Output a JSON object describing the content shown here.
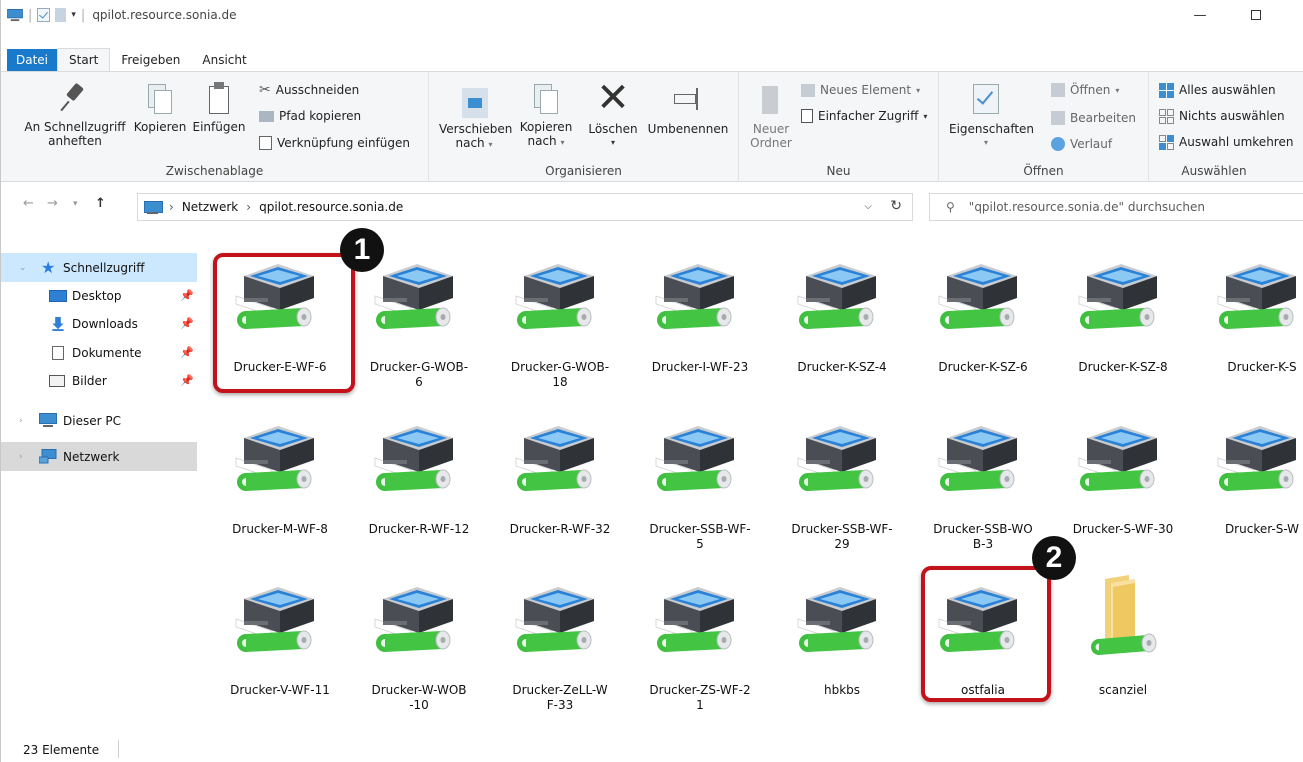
{
  "window": {
    "title": "qpilot.resource.sonia.de"
  },
  "ribbon_tabs": [
    {
      "label": "Datei"
    },
    {
      "label": "Start"
    },
    {
      "label": "Freigeben"
    },
    {
      "label": "Ansicht"
    }
  ],
  "ribbon": {
    "clipboard": {
      "pin_line1": "An Schnellzugriff",
      "pin_line2": "anheften",
      "copy": "Kopieren",
      "paste": "Einfügen",
      "cut": "Ausschneiden",
      "copy_path": "Pfad kopieren",
      "paste_shortcut": "Verknüpfung einfügen",
      "group": "Zwischenablage"
    },
    "organize": {
      "move_line1": "Verschieben",
      "move_line2": "nach",
      "copyto_line1": "Kopieren",
      "copyto_line2": "nach",
      "delete": "Löschen",
      "rename": "Umbenennen",
      "group": "Organisieren"
    },
    "new": {
      "folder_line1": "Neuer",
      "folder_line2": "Ordner",
      "new_item": "Neues Element",
      "easy_access": "Einfacher Zugriff",
      "group": "Neu"
    },
    "open": {
      "properties": "Eigenschaften",
      "open": "Öffnen",
      "edit": "Bearbeiten",
      "history": "Verlauf",
      "group": "Öffnen"
    },
    "select": {
      "select_all": "Alles auswählen",
      "select_none": "Nichts auswählen",
      "invert": "Auswahl umkehren",
      "group": "Auswählen"
    }
  },
  "address": {
    "crumb1": "Netzwerk",
    "crumb2": "qpilot.resource.sonia.de",
    "search_placeholder": "\"qpilot.resource.sonia.de\" durchsuchen"
  },
  "navpane": {
    "quick_access": "Schnellzugriff",
    "desktop": "Desktop",
    "downloads": "Downloads",
    "documents": "Dokumente",
    "pictures": "Bilder",
    "this_pc": "Dieser PC",
    "network": "Netzwerk"
  },
  "items": [
    {
      "line1": "Drucker-E-WF-6",
      "line2": ""
    },
    {
      "line1": "Drucker-G-WOB-",
      "line2": "6"
    },
    {
      "line1": "Drucker-G-WOB-",
      "line2": "18"
    },
    {
      "line1": "Drucker-I-WF-23",
      "line2": ""
    },
    {
      "line1": "Drucker-K-SZ-4",
      "line2": ""
    },
    {
      "line1": "Drucker-K-SZ-6",
      "line2": ""
    },
    {
      "line1": "Drucker-K-SZ-8",
      "line2": ""
    },
    {
      "line1": "Drucker-K-S",
      "line2": ""
    },
    {
      "line1": "Drucker-M-WF-8",
      "line2": ""
    },
    {
      "line1": "Drucker-R-WF-12",
      "line2": ""
    },
    {
      "line1": "Drucker-R-WF-32",
      "line2": ""
    },
    {
      "line1": "Drucker-SSB-WF-",
      "line2": "5"
    },
    {
      "line1": "Drucker-SSB-WF-",
      "line2": "29"
    },
    {
      "line1": "Drucker-SSB-WO",
      "line2": "B-3"
    },
    {
      "line1": "Drucker-S-WF-30",
      "line2": ""
    },
    {
      "line1": "Drucker-S-W",
      "line2": ""
    },
    {
      "line1": "Drucker-V-WF-11",
      "line2": ""
    },
    {
      "line1": "Drucker-W-WOB",
      "line2": "-10"
    },
    {
      "line1": "Drucker-ZeLL-W",
      "line2": "F-33"
    },
    {
      "line1": "Drucker-ZS-WF-2",
      "line2": "1"
    },
    {
      "line1": "hbkbs",
      "line2": ""
    },
    {
      "line1": "ostfalia",
      "line2": ""
    },
    {
      "line1": "scanziel",
      "line2": ""
    }
  ],
  "annotations": {
    "badge1": "1",
    "badge2": "2"
  },
  "status": {
    "count": "23 Elemente"
  },
  "colors": {
    "accent": "#1979ca",
    "highlight": "#c4121a",
    "selection": "#cce8ff"
  }
}
